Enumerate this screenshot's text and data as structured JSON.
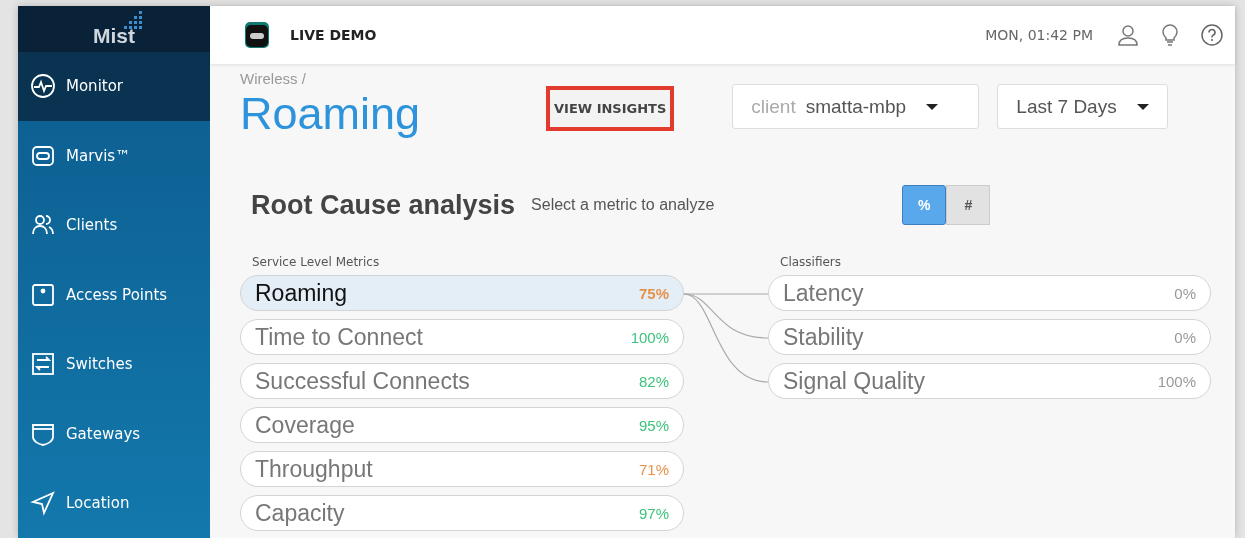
{
  "sidebar": {
    "logo": "Mist",
    "items": [
      {
        "label": "Monitor",
        "selected": true
      },
      {
        "label": "Marvis™",
        "selected": false
      },
      {
        "label": "Clients",
        "selected": false
      },
      {
        "label": "Access Points",
        "selected": false
      },
      {
        "label": "Switches",
        "selected": false
      },
      {
        "label": "Gateways",
        "selected": false
      },
      {
        "label": "Location",
        "selected": false
      }
    ]
  },
  "header": {
    "title": "LIVE DEMO",
    "datetime": "MON, 01:42 PM"
  },
  "breadcrumb": "Wireless /",
  "page_title": "Roaming",
  "insights_button": "VIEW INSIGHTS",
  "filters": [
    {
      "label": "client",
      "value": "smatta-mbp"
    },
    {
      "value": "Last 7 Days"
    }
  ],
  "section": {
    "title": "Root Cause analysis",
    "subtitle": "Select a metric to analyze"
  },
  "toggle": [
    {
      "label": "%",
      "selected": true
    },
    {
      "label": "#",
      "selected": false
    }
  ],
  "metrics_heading": "Service Level Metrics",
  "metrics": [
    {
      "name": "Roaming",
      "value": "75%",
      "color": "#e8914a",
      "selected": true
    },
    {
      "name": "Time to Connect",
      "value": "100%",
      "color": "#3cc47c",
      "selected": false
    },
    {
      "name": "Successful Connects",
      "value": "82%",
      "color": "#3cc47c",
      "selected": false
    },
    {
      "name": "Coverage",
      "value": "95%",
      "color": "#3cc47c",
      "selected": false
    },
    {
      "name": "Throughput",
      "value": "71%",
      "color": "#e8914a",
      "selected": false
    },
    {
      "name": "Capacity",
      "value": "97%",
      "color": "#3cc47c",
      "selected": false
    }
  ],
  "classifiers_heading": "Classifiers",
  "classifiers": [
    {
      "name": "Latency",
      "value": "0%"
    },
    {
      "name": "Stability",
      "value": "0%"
    },
    {
      "name": "Signal Quality",
      "value": "100%"
    }
  ]
}
